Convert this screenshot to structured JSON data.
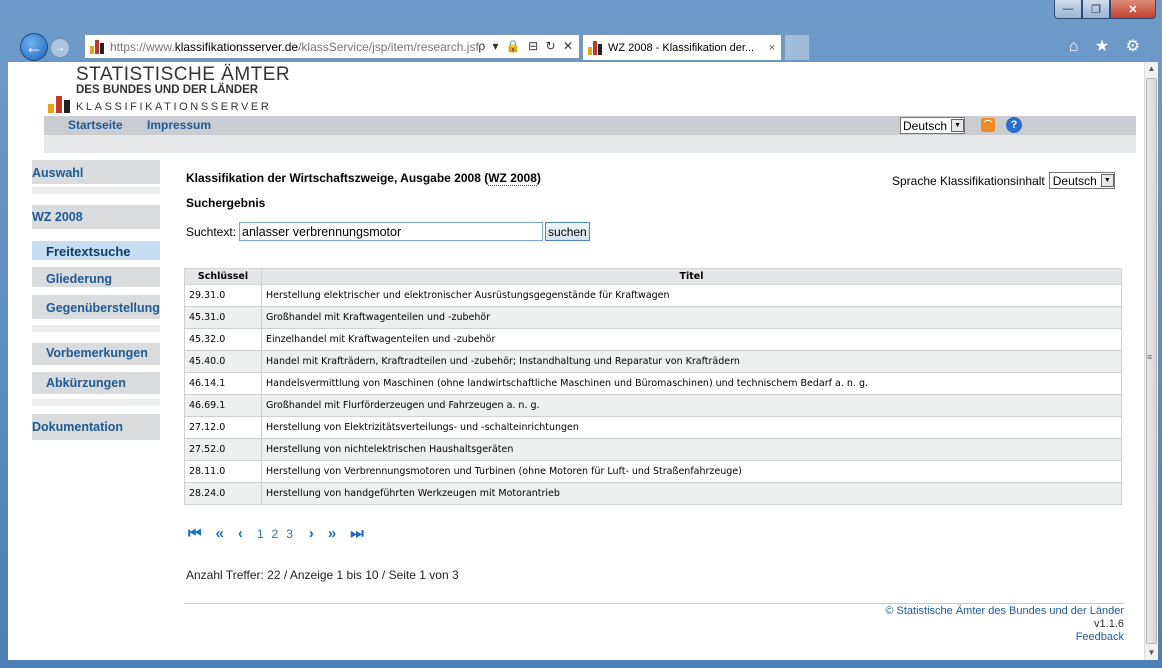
{
  "browser": {
    "url_prefix": "https://www.",
    "url_domain": "klassifikationsserver.de",
    "url_path": "/klassService/jsp/item/research.jsf",
    "tab_title": "WZ 2008 - Klassifikation der...",
    "tab_close": "×",
    "address_tools": "ρ ▾ 🔒 ⊟ ↻ ✕",
    "chrome_icons": "⌂ ★ ⚙",
    "win_min": "—",
    "win_max": "❐",
    "win_close": "✕",
    "back": "←",
    "fwd": "→"
  },
  "header": {
    "logo_line1": "STATISTISCHE ÄMTER",
    "logo_line2": "DES BUNDES UND DER LÄNDER",
    "logo_line3": "KLASSIFIKATIONSSERVER"
  },
  "topnav": {
    "startseite": "Startseite",
    "impressum": "Impressum",
    "language": "Deutsch",
    "rss": "⌒",
    "help": "?"
  },
  "sidebar": {
    "auswahl": "Auswahl",
    "wz": "WZ 2008",
    "freitextsuche": "Freitextsuche",
    "gliederung": "Gliederung",
    "gegenueber": "Gegenüberstellung",
    "vorbemerkungen": "Vorbemerkungen",
    "abkuerzungen": "Abkürzungen",
    "dokumentation": "Dokumentation"
  },
  "main": {
    "title_prefix": "Klassifikation der Wirtschaftszweige, Ausgabe 2008 (",
    "title_abbr": "WZ 2008",
    "title_suffix": ")",
    "sprache_label": "Sprache Klassifikationsinhalt",
    "sprache_value": "Deutsch",
    "subtitle": "Suchergebnis",
    "search_label": "Suchtext:",
    "search_value": "anlasser verbrennungsmotor",
    "search_button": "suchen"
  },
  "table": {
    "col_key": "Schlüssel",
    "col_title": "Titel",
    "rows": [
      {
        "key": "29.31.0",
        "title": "Herstellung elektrischer und elektronischer Ausrüstungsgegenstände für Kraftwagen"
      },
      {
        "key": "45.31.0",
        "title": "Großhandel mit Kraftwagenteilen und -zubehör"
      },
      {
        "key": "45.32.0",
        "title": "Einzelhandel mit Kraftwagenteilen und -zubehör"
      },
      {
        "key": "45.40.0",
        "title": "Handel mit Krafträdern, Kraftradteilen und -zubehör; Instandhaltung und Reparatur von Krafträdern"
      },
      {
        "key": "46.14.1",
        "title": "Handelsvermittlung von Maschinen (ohne landwirtschaftliche Maschinen und Büromaschinen) und technischem Bedarf a. n. g."
      },
      {
        "key": "46.69.1",
        "title": "Großhandel mit Flurförderzeugen und Fahrzeugen a. n. g."
      },
      {
        "key": "27.12.0",
        "title": "Herstellung von Elektrizitätsverteilungs- und -schalteinrichtungen"
      },
      {
        "key": "27.52.0",
        "title": "Herstellung von nichtelektrischen Haushaltsgeräten"
      },
      {
        "key": "28.11.0",
        "title": "Herstellung von Verbrennungsmotoren und Turbinen (ohne Motoren für Luft- und Straßenfahrzeuge)"
      },
      {
        "key": "28.24.0",
        "title": "Herstellung von handgeführten Werkzeugen mit Motorantrieb"
      }
    ]
  },
  "pager": {
    "first": "⏮",
    "prevpage": "«",
    "prev": "‹",
    "pages": [
      "1",
      "2",
      "3"
    ],
    "next": "›",
    "nextpage": "»",
    "last": "⏭"
  },
  "summary": "Anzahl Treffer: 22  /  Anzeige 1 bis 10  /  Seite 1 von 3",
  "footer": {
    "copyright": "© Statistische Ämter des Bundes und der Länder",
    "version": "v1.1.6",
    "feedback": "Feedback"
  }
}
